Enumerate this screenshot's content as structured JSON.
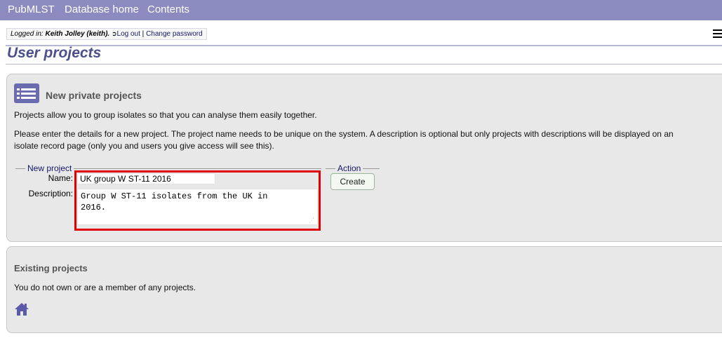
{
  "nav": {
    "brand": "PubMLST",
    "database_home": "Database home",
    "contents": "Contents"
  },
  "login": {
    "prefix": "Logged in: ",
    "user": "Keith Jolley (keith).",
    "logout": "Log out",
    "separator": "|",
    "change_password": "Change password"
  },
  "page_title": "User projects",
  "new_projects": {
    "heading": "New private projects",
    "intro": "Projects allow you to group isolates so that you can analyse them easily together.",
    "details_line1": "Please enter the details for a new project. The project name needs to be unique on the system. A description is optional but only projects with descriptions will be displayed on an",
    "details_line2": "isolate record page (only you and users you give access will see this).",
    "fieldset_legend": "New project",
    "name_label": "Name:",
    "name_value": "UK group W ST-11 2016",
    "description_label": "Description:",
    "description_value": "Group W ST-11 isolates from the UK in\n2016.",
    "action_legend": "Action",
    "create_button": "Create"
  },
  "existing_projects": {
    "heading": "Existing projects",
    "message": "You do not own or are a member of any projects."
  },
  "colors": {
    "nav_bg": "#8b8bc0",
    "title": "#4d4e8c",
    "highlight": "#e00000"
  },
  "icons": {
    "list": "list-icon",
    "home": "home-icon",
    "logout": "logout-icon",
    "menu": "hamburger-menu-icon"
  }
}
